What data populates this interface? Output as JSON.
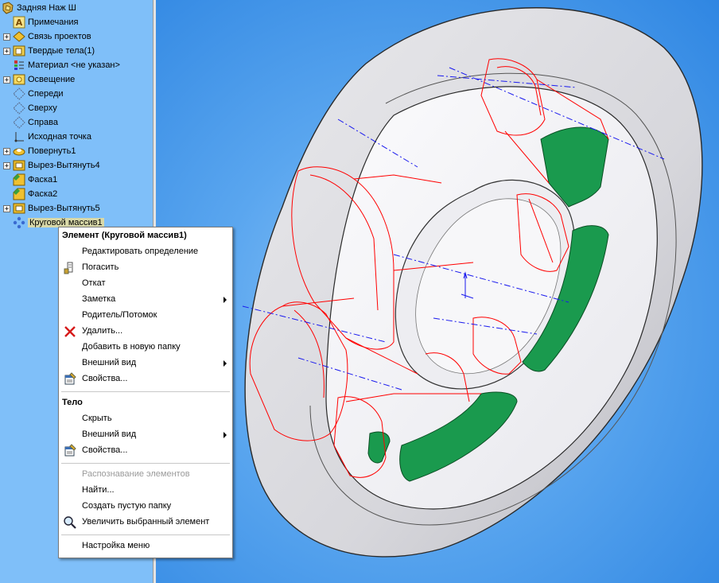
{
  "tree": {
    "root": {
      "label": "Задняя Наж Ш",
      "icon": "part-icon"
    },
    "items": [
      {
        "label": "Примечания",
        "icon": "annotations-icon",
        "expandable": false
      },
      {
        "label": "Связь проектов",
        "icon": "design-binder-icon",
        "expandable": true
      },
      {
        "label": "Твердые тела(1)",
        "icon": "solid-bodies-icon",
        "expandable": true
      },
      {
        "label": "Материал <не указан>",
        "icon": "material-icon",
        "expandable": false
      },
      {
        "label": "Освещение",
        "icon": "lighting-icon",
        "expandable": true
      },
      {
        "label": "Спереди",
        "icon": "plane-icon",
        "expandable": false
      },
      {
        "label": "Сверху",
        "icon": "plane-icon",
        "expandable": false
      },
      {
        "label": "Справа",
        "icon": "plane-icon",
        "expandable": false
      },
      {
        "label": "Исходная точка",
        "icon": "origin-icon",
        "expandable": false
      },
      {
        "label": "Повернуть1",
        "icon": "revolve-icon",
        "expandable": true
      },
      {
        "label": "Вырез-Вытянуть4",
        "icon": "cut-extrude-icon",
        "expandable": true
      },
      {
        "label": "Фаска1",
        "icon": "chamfer-icon",
        "expandable": false
      },
      {
        "label": "Фаска2",
        "icon": "chamfer-icon",
        "expandable": false
      },
      {
        "label": "Вырез-Вытянуть5",
        "icon": "cut-extrude-icon",
        "expandable": true
      },
      {
        "label": "Круговой массив1",
        "icon": "circular-pattern-icon",
        "expandable": false,
        "selected": true
      }
    ]
  },
  "menu": {
    "feature_header": "Элемент (Круговой массив1)",
    "edit_definition": "Редактировать определение",
    "suppress": "Погасить",
    "rollback": "Откат",
    "comment": "Заметка",
    "parent_child": "Родитель/Потомок",
    "delete": "Удалить...",
    "add_to_folder": "Добавить в новую папку",
    "appearance": "Внешний вид",
    "properties": "Свойства...",
    "body_header": "Тело",
    "hide": "Скрыть",
    "body_appearance": "Внешний вид",
    "body_properties": "Свойства...",
    "feature_recognition": "Распознавание элементов",
    "find": "Найти...",
    "create_empty_folder": "Создать пустую папку",
    "zoom_to_selection": "Увеличить выбранный элемент",
    "customize_menu": "Настройка меню"
  },
  "colors": {
    "tree_bg": "#7fbff9",
    "viewport_bg": "#5aa6ef",
    "model_face": "#f2f2f4",
    "cut_face": "#1a9a4e",
    "edge_highlight": "#ff0000",
    "axis": "#0000cc"
  }
}
